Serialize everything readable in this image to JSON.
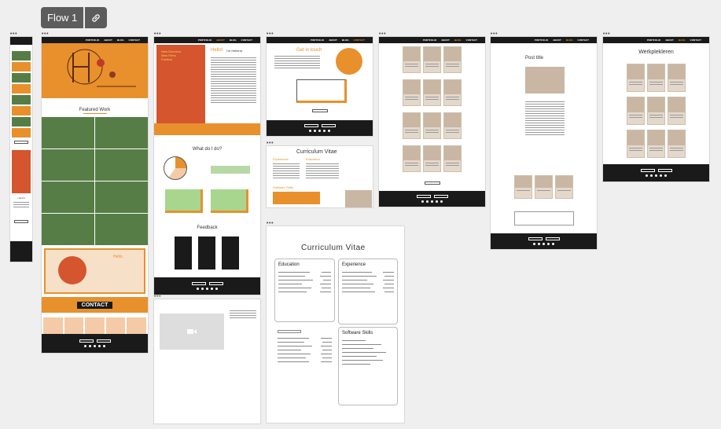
{
  "flow": {
    "label": "Flow 1",
    "link_icon": "link-icon"
  },
  "nav": {
    "items": [
      "PORTFOLIO",
      "ABOUT",
      "BLOG",
      "CONTACT"
    ]
  },
  "frames": {
    "home": {
      "featured_title": "Featured Work",
      "hello": "Hello,",
      "contact": "CONTACT"
    },
    "about": {
      "hello": "Hello!",
      "name": "I'm Hellena",
      "festival": "New Directors New Films Festival",
      "what": "What do I do?",
      "feedback": "Feedback"
    },
    "contact": {
      "title": "Get in touch"
    },
    "cv_small": {
      "title": "Curriculum Vitae",
      "education": "Education",
      "experience": "Experience",
      "skills": "Software Skills"
    },
    "post": {
      "title": "Post title"
    },
    "work": {
      "title": "Werkplekleren"
    },
    "cv_large": {
      "title": "Curriculum Vitae",
      "education": "Education",
      "experience": "Experience",
      "skills": "Software Skills"
    }
  },
  "colors": {
    "accent": "#e8902c",
    "green": "#567d46",
    "dark": "#1a1a1a",
    "tan": "#c9b7a3"
  }
}
